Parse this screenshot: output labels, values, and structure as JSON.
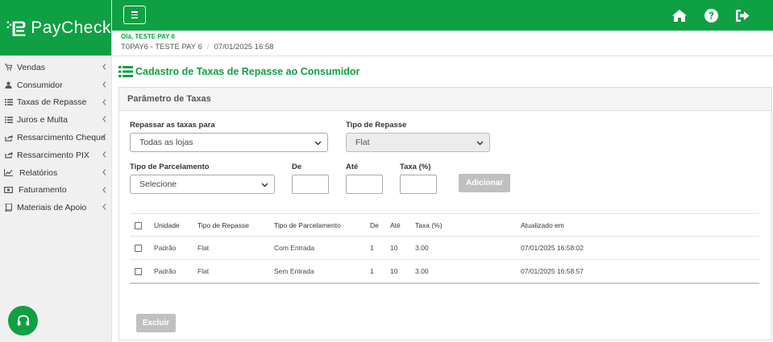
{
  "app": {
    "logo_text": "PayCheck"
  },
  "sidebar": {
    "items": [
      {
        "label": "Vendas",
        "icon": "cart-icon"
      },
      {
        "label": "Consumidor",
        "icon": "user-icon"
      },
      {
        "label": "Taxas de Repasse",
        "icon": "list-icon"
      },
      {
        "label": "Juros e Multa",
        "icon": "list-icon"
      },
      {
        "label": "Ressarcimento Cheque",
        "icon": "external-link-icon"
      },
      {
        "label": "Ressarcimento PIX",
        "icon": "external-link-icon"
      },
      {
        "label": "Relatórios",
        "icon": "line-chart-icon"
      },
      {
        "label": "Faturamento",
        "icon": "money-icon"
      },
      {
        "label": "Materiais de Apoio",
        "icon": "book-icon"
      }
    ]
  },
  "header": {
    "greeting": "Olá, TESTE PAY 6",
    "company": "T0PAY6 - TESTE PAY 6",
    "datetime": "07/01/2025 16:58"
  },
  "page": {
    "title": "Cadastro de Taxas de Repasse ao Consumidor"
  },
  "panel": {
    "title": "Parâmetro de Taxas",
    "repassar": {
      "label": "Repassar as taxas para",
      "value": "Todas as lojas"
    },
    "tipo_repasse": {
      "label": "Tipo de Repasse",
      "value": "Flat"
    },
    "tipo_parcelamento": {
      "label": "Tipo de Parcelamento",
      "value": "Selecione"
    },
    "de": {
      "label": "De",
      "value": ""
    },
    "ate": {
      "label": "Até",
      "value": ""
    },
    "taxa": {
      "label": "Taxa (%)",
      "value": ""
    },
    "add_button": "Adicionar",
    "delete_button": "Excluir"
  },
  "table": {
    "headers": [
      "Unidade",
      "Tipo de Repasse",
      "Tipo de Parcelamento",
      "De",
      "Até",
      "Taxa (%)",
      "Atualizado em"
    ],
    "rows": [
      [
        "Padrão",
        "Flat",
        "Com Entrada",
        "1",
        "10",
        "3.00",
        "07/01/2025 16:58:02"
      ],
      [
        "Padrão",
        "Flat",
        "Sem Entrada",
        "1",
        "10",
        "3.00",
        "07/01/2025 16:58:57"
      ]
    ]
  },
  "colors": {
    "brand": "#0fa044",
    "sidebar_bg": "#f0f0f0",
    "disabled_button": "#c0c0c0"
  }
}
